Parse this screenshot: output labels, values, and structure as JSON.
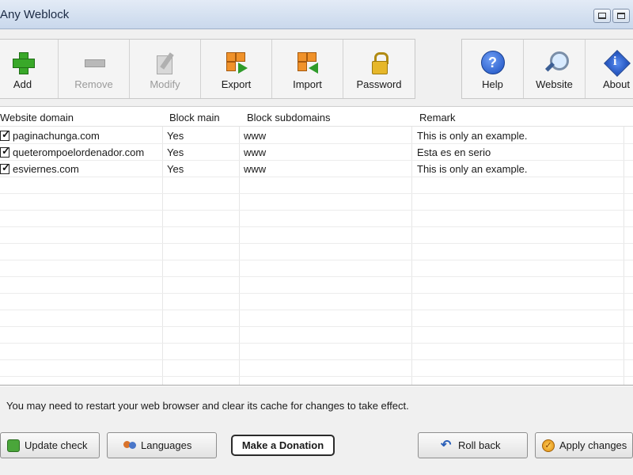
{
  "window": {
    "title": "Any Weblock"
  },
  "toolbar": {
    "left": [
      {
        "label": "Add",
        "icon": "add-icon",
        "enabled": true
      },
      {
        "label": "Remove",
        "icon": "remove-icon",
        "enabled": false
      },
      {
        "label": "Modify",
        "icon": "modify-icon",
        "enabled": false
      },
      {
        "label": "Export",
        "icon": "export-icon",
        "enabled": true
      },
      {
        "label": "Import",
        "icon": "import-icon",
        "enabled": true
      },
      {
        "label": "Password",
        "icon": "lock-icon",
        "enabled": true
      }
    ],
    "right": [
      {
        "label": "Help",
        "icon": "help-icon"
      },
      {
        "label": "Website",
        "icon": "magnifier-icon"
      },
      {
        "label": "About",
        "icon": "info-icon"
      }
    ]
  },
  "table": {
    "columns": [
      "Website domain",
      "Block main",
      "Block subdomains",
      "Remark"
    ],
    "rows": [
      {
        "checked": true,
        "domain": "paginachunga.com",
        "block_main": "Yes",
        "subdomains": "www",
        "remark": "This is only an example."
      },
      {
        "checked": true,
        "domain": "queterompoelordenador.com",
        "block_main": "Yes",
        "subdomains": "www",
        "remark": "Esta es en serio"
      },
      {
        "checked": true,
        "domain": "esviernes.com",
        "block_main": "Yes",
        "subdomains": "www",
        "remark": "This is only an example."
      }
    ]
  },
  "status": {
    "message": "You may need to restart your web browser and clear its cache for changes to take effect."
  },
  "buttons": {
    "update_check": "Update check",
    "languages": "Languages",
    "donate": "Make a Donation",
    "roll_back": "Roll back",
    "apply": "Apply changes"
  }
}
